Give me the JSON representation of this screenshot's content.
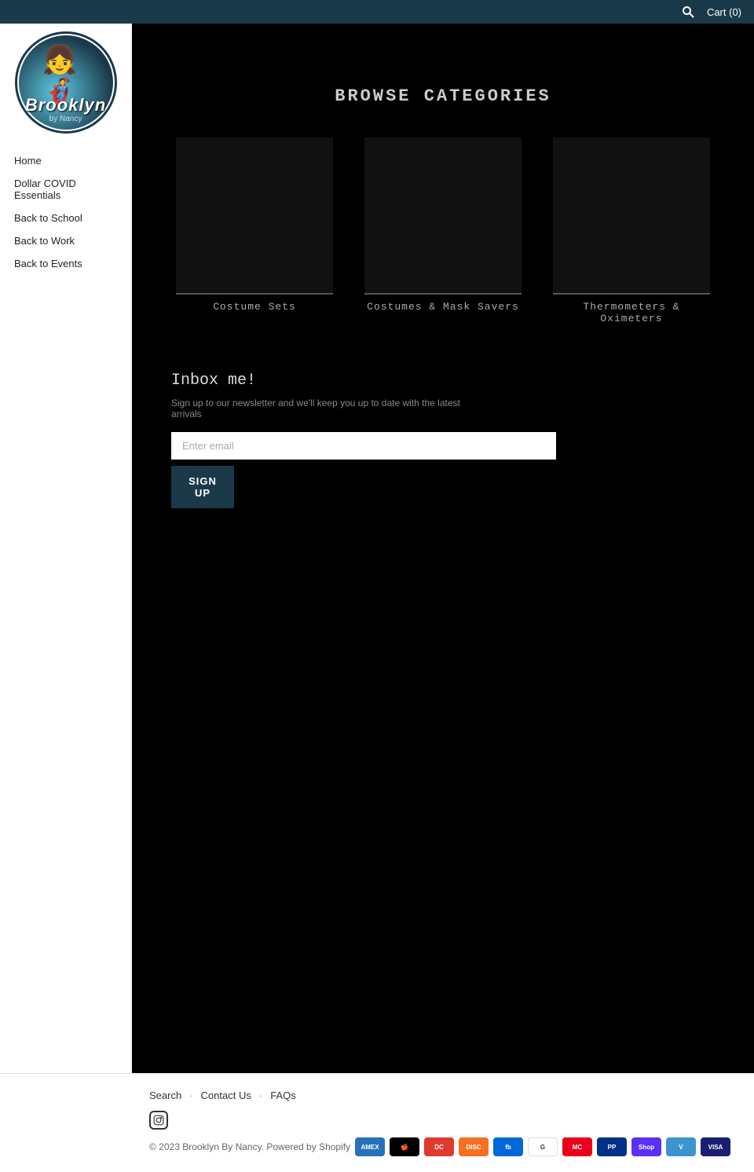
{
  "topbar": {
    "search_label": "Search",
    "cart_label": "Cart (0)"
  },
  "sidebar": {
    "nav_items": [
      {
        "label": "Home",
        "id": "home"
      },
      {
        "label": "Dollar COVID Essentials",
        "id": "covid"
      },
      {
        "label": "Back to School",
        "id": "back-to-school"
      },
      {
        "label": "Back to Work",
        "id": "back-to-work"
      },
      {
        "label": "Back to Events",
        "id": "back-to-events"
      }
    ]
  },
  "main": {
    "browse_title": "BROWSE CATEGORIES",
    "categories": [
      {
        "id": "costumes-sets",
        "label": "Costume Sets"
      },
      {
        "id": "costumes-masks",
        "label": "Costumes & Mask Savers"
      },
      {
        "id": "thermometers",
        "label": "Thermometers & Oximeters"
      }
    ]
  },
  "newsletter": {
    "title": "Inbox me!",
    "subtitle": "Sign up to our newsletter and we'll keep you up to date with the latest arrivals",
    "input_placeholder": "Enter email",
    "button_label": "SIGN UP"
  },
  "footer": {
    "links": [
      {
        "label": "Search",
        "id": "search"
      },
      {
        "label": "Contact Us",
        "id": "contact"
      },
      {
        "label": "FAQs",
        "id": "faqs"
      }
    ],
    "copyright": "© 2023 Brooklyn By Nancy. Powered by Shopify",
    "payment_methods": [
      {
        "name": "American Express",
        "short": "AMEX",
        "class": "pi-amex"
      },
      {
        "name": "Apple Pay",
        "short": "🍎",
        "class": "pi-apple"
      },
      {
        "name": "Diners Club",
        "short": "DC",
        "class": "pi-diners"
      },
      {
        "name": "Discover",
        "short": "DISC",
        "class": "pi-discover"
      },
      {
        "name": "Meta Pay",
        "short": "fb",
        "class": "pi-meta"
      },
      {
        "name": "Google Pay",
        "short": "G",
        "class": "pi-google"
      },
      {
        "name": "Mastercard",
        "short": "MC",
        "class": "pi-master"
      },
      {
        "name": "PayPal",
        "short": "PP",
        "class": "pi-paypal"
      },
      {
        "name": "Shop Pay",
        "short": "Shop",
        "class": "pi-shopay"
      },
      {
        "name": "Venmo",
        "short": "V",
        "class": "pi-venmo"
      },
      {
        "name": "Visa",
        "short": "VISA",
        "class": "pi-visa"
      }
    ]
  }
}
